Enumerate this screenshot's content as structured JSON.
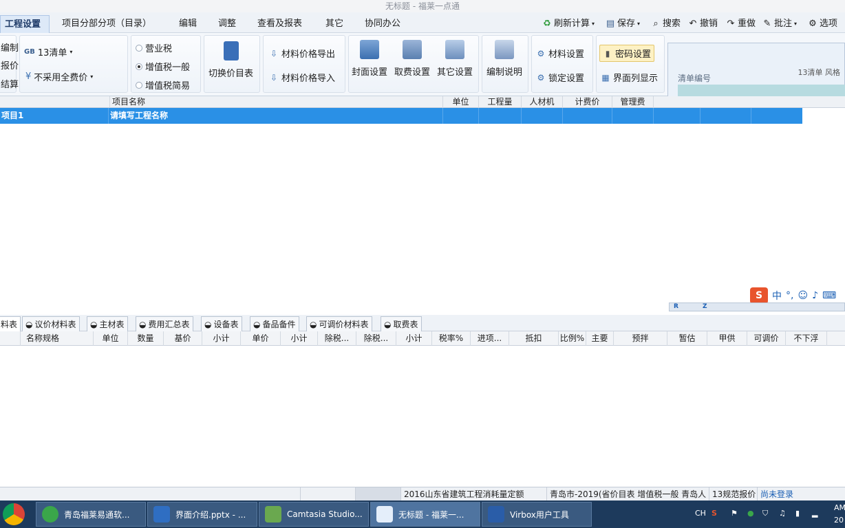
{
  "window": {
    "title": "无标题 - 福莱一点通"
  },
  "menu": {
    "items": [
      "工程设置",
      "项目分部分项（目录）",
      "编辑",
      "调整",
      "查看及报表",
      "其它",
      "协同办公"
    ],
    "active_index": 0,
    "tools": {
      "refresh": "刷新计算",
      "save": "保存",
      "search": "搜索",
      "undo": "撤销",
      "redo": "重做",
      "annotate": "批注",
      "options": "选项"
    }
  },
  "ribbon": {
    "left_cut": [
      "编制",
      "报价",
      "结算"
    ],
    "gb_prefix": "GB",
    "gb_label": "13清单",
    "price_mode": "不采用全费价",
    "tax_options": [
      {
        "label": "营业税",
        "selected": false
      },
      {
        "label": "增值税一般",
        "selected": true
      },
      {
        "label": "增值税简易",
        "selected": false
      }
    ],
    "switch_catalog": "切换价目表",
    "material_export": "材料价格导出",
    "material_import": "材料价格导入",
    "cover_settings": "封面设置",
    "fee_settings": "取费设置",
    "other_settings": "其它设置",
    "compile_notes": "编制说明",
    "material_settings": "材料设置",
    "lock_settings": "锁定设置",
    "password_settings": "密码设置",
    "column_display": "界面列显示"
  },
  "right_panel": {
    "label": "清单编号",
    "code": "13清单 风格"
  },
  "grid": {
    "headers": [
      "项目名称",
      "单位",
      "工程量",
      "人材机",
      "计费价",
      "管理费"
    ],
    "selected_row": {
      "code": "项目1",
      "name": "请填写工程名称"
    }
  },
  "ime": {
    "zh": "中",
    "punct": "°,"
  },
  "mini_toolbar": {
    "r": "R",
    "z": "Z"
  },
  "bottom_tabs": [
    "料表",
    "议价材料表",
    "主材表",
    "费用汇总表",
    "设备表",
    "备品备件",
    "可调价材料表",
    "取费表"
  ],
  "bottom_tab_active": 0,
  "bottom_columns": [
    "名称规格",
    "单位",
    "数量",
    "基价",
    "小计",
    "单价",
    "小计",
    "除税...",
    "除税...",
    "小计",
    "税率%",
    "进项...",
    "抵扣",
    "比例%",
    "主要",
    "预拌",
    "暂估",
    "甲供",
    "可调价",
    "不下浮"
  ],
  "status": {
    "quota": "2016山东省建筑工程消耗量定额",
    "price_table": "青岛市-2019(省价目表 增值税一般 青岛人",
    "spec": "13规范报价",
    "login": "尚未登录"
  },
  "taskbar": {
    "items": [
      "青岛福莱易通软...",
      "界面介绍.pptx - ...",
      "Camtasia Studio...",
      "无标题 - 福莱一...",
      "Virbox用户工具"
    ],
    "tray_lang": "CH",
    "clock_top": "AM",
    "clock_bottom": "20"
  },
  "colors": {
    "selected_row": "#2a90e6",
    "menu_bg": "#eef2f7",
    "taskbar": "#1d3a5c",
    "login_link": "#1a5fb4"
  }
}
